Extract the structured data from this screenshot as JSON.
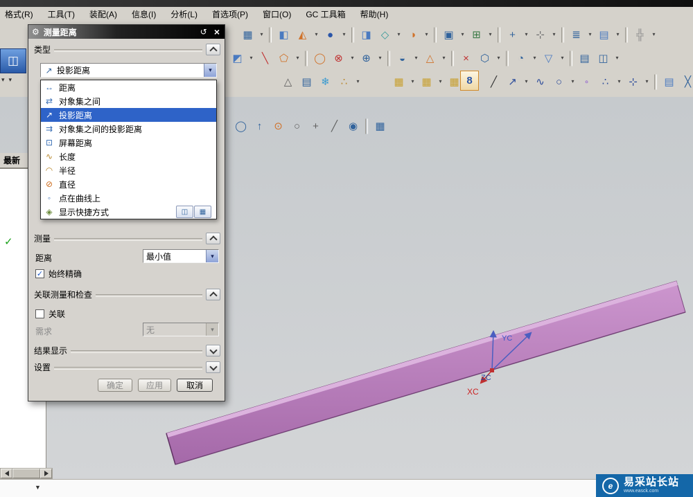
{
  "menu": {
    "items": [
      {
        "label": "格式(R)"
      },
      {
        "label": "工具(T)"
      },
      {
        "label": "装配(A)"
      },
      {
        "label": "信息(I)"
      },
      {
        "label": "分析(L)"
      },
      {
        "label": "首选项(P)"
      },
      {
        "label": "窗口(O)"
      },
      {
        "label": "GC 工具箱"
      },
      {
        "label": "帮助(H)"
      }
    ]
  },
  "icons": {
    "gear": "⚙",
    "reset": "↺",
    "close": "×",
    "dropdown": "▾",
    "check": "✓",
    "link": "8",
    "combo_icon": "↗",
    "shortcut_a": "◫",
    "shortcut_b": "▦",
    "window_frag": "◫",
    "spark_frag": "◈",
    "caret_down": "▼",
    "green_check": "✓",
    "logo_letter": "e"
  },
  "toolbars": {
    "row1": [
      {
        "g": "▦",
        "c": "#31639c",
        "n": "view-layout-icon"
      },
      {
        "g": "▾",
        "a": 1,
        "n": "dropdown-arrow"
      },
      {
        "s": 1,
        "n": "separator"
      },
      {
        "g": "◧",
        "c": "#4a7ac0",
        "n": "shaded-view-icon"
      },
      {
        "g": "◭",
        "c": "#d0722a",
        "n": "orient-view-icon"
      },
      {
        "g": "▾",
        "a": 1,
        "n": "dropdown-arrow"
      },
      {
        "g": "●",
        "c": "#2a55a8",
        "n": "render-style-icon"
      },
      {
        "g": "▾",
        "a": 1,
        "n": "dropdown-arrow"
      },
      {
        "s": 1,
        "n": "separator"
      },
      {
        "g": "◨",
        "c": "#4a7ac0",
        "n": "half-section-icon"
      },
      {
        "g": "◇",
        "c": "#3a9a9a",
        "n": "wireframe-icon"
      },
      {
        "g": "▾",
        "a": 1,
        "n": "dropdown-arrow"
      },
      {
        "g": "◑",
        "c": "#d0722a",
        "n": "shadow-icon"
      },
      {
        "g": "▾",
        "a": 1,
        "n": "dropdown-arrow"
      },
      {
        "s": 1,
        "n": "separator"
      },
      {
        "g": "▣",
        "c": "#31639c",
        "n": "window-icon"
      },
      {
        "g": "▾",
        "a": 1,
        "n": "dropdown-arrow"
      },
      {
        "g": "⊞",
        "c": "#3a7a46",
        "n": "layer-icon"
      },
      {
        "g": "▾",
        "a": 1,
        "n": "dropdown-arrow"
      },
      {
        "s": 1,
        "n": "separator"
      },
      {
        "g": "+",
        "c": "#31639c",
        "n": "datum-icon"
      },
      {
        "g": "▾",
        "a": 1,
        "n": "dropdown-arrow"
      },
      {
        "g": "⊹",
        "c": "#707070",
        "n": "point-icon"
      },
      {
        "g": "▾",
        "a": 1,
        "n": "dropdown-arrow"
      },
      {
        "s": 1,
        "n": "separator"
      },
      {
        "g": "≣",
        "c": "#31639c",
        "n": "list-icon"
      },
      {
        "g": "▾",
        "a": 1,
        "n": "dropdown-arrow"
      },
      {
        "g": "▤",
        "c": "#4a7ac0",
        "n": "table-icon"
      },
      {
        "g": "▾",
        "a": 1,
        "n": "dropdown-arrow"
      },
      {
        "s": 1,
        "n": "separator"
      },
      {
        "g": "╬",
        "c": "#8a8a8a",
        "n": "grid-icon"
      },
      {
        "g": "▾",
        "a": 1,
        "n": "dropdown-arrow"
      }
    ],
    "row2": [
      {
        "g": "◩",
        "c": "#4a7ac0",
        "n": "extrude-icon"
      },
      {
        "g": "▾",
        "a": 1,
        "n": "dropdown-arrow"
      },
      {
        "g": "╲",
        "c": "#c03434",
        "n": "line-icon"
      },
      {
        "g": "⬠",
        "c": "#d0722a",
        "n": "polygon-icon"
      },
      {
        "g": "▾",
        "a": 1,
        "n": "dropdown-arrow"
      },
      {
        "s": 1,
        "n": "separator"
      },
      {
        "g": "◯",
        "c": "#d0722a",
        "n": "circle-icon"
      },
      {
        "g": "⊗",
        "c": "#c03434",
        "n": "hole-icon"
      },
      {
        "g": "▾",
        "a": 1,
        "n": "dropdown-arrow"
      },
      {
        "g": "⊕",
        "c": "#31639c",
        "n": "boolean-unite-icon"
      },
      {
        "g": "▾",
        "a": 1,
        "n": "dropdown-arrow"
      },
      {
        "s": 1,
        "n": "separator"
      },
      {
        "g": "◒",
        "c": "#31639c",
        "n": "revolve-icon"
      },
      {
        "g": "▾",
        "a": 1,
        "n": "dropdown-arrow"
      },
      {
        "g": "△",
        "c": "#d0722a",
        "n": "draft-icon"
      },
      {
        "g": "▾",
        "a": 1,
        "n": "dropdown-arrow"
      },
      {
        "s": 1,
        "n": "separator"
      },
      {
        "g": "×",
        "c": "#c03434",
        "n": "delete-icon"
      },
      {
        "g": "⬡",
        "c": "#31639c",
        "n": "pattern-icon"
      },
      {
        "g": "▾",
        "a": 1,
        "n": "dropdown-arrow"
      },
      {
        "s": 1,
        "n": "separator"
      },
      {
        "g": "◔",
        "c": "#31639c",
        "n": "blend-icon"
      },
      {
        "g": "▾",
        "a": 1,
        "n": "dropdown-arrow"
      },
      {
        "g": "▽",
        "c": "#4a7ac0",
        "n": "chamfer-icon"
      },
      {
        "g": "▾",
        "a": 1,
        "n": "dropdown-arrow"
      },
      {
        "s": 1,
        "n": "separator"
      },
      {
        "g": "▤",
        "c": "#31639c",
        "n": "sheet-icon"
      },
      {
        "g": "◫",
        "c": "#31639c",
        "n": "shell-icon"
      },
      {
        "g": "▾",
        "a": 1,
        "n": "dropdown-arrow"
      }
    ],
    "row3a": [
      {
        "g": "△",
        "c": "#606060",
        "n": "tolerance-icon"
      },
      {
        "g": "▤",
        "c": "#31639c",
        "n": "spreadsheet-icon"
      },
      {
        "g": "❄",
        "c": "#3a9ad0",
        "n": "freeze-icon"
      },
      {
        "g": "∴",
        "c": "#b8862a",
        "n": "points-set-icon"
      },
      {
        "g": "▾",
        "a": 1,
        "n": "dropdown-arrow"
      }
    ],
    "row3b": [
      {
        "g": "▦",
        "c": "#c8a030",
        "n": "group-icon"
      },
      {
        "g": "▾",
        "a": 1,
        "n": "dropdown-arrow"
      },
      {
        "g": "▦",
        "c": "#c8a030",
        "n": "group-icon"
      },
      {
        "g": "▾",
        "a": 1,
        "n": "dropdown-arrow"
      },
      {
        "g": "▦",
        "c": "#c8a030",
        "n": "group-icon"
      },
      {
        "g": "▾",
        "a": 1,
        "n": "dropdown-arrow"
      }
    ],
    "row3c": [
      {
        "g": "╱",
        "c": "#333333",
        "n": "profile-line-icon"
      },
      {
        "g": "↗",
        "c": "#2a4a9a",
        "n": "arc-icon"
      },
      {
        "g": "▾",
        "a": 1,
        "n": "dropdown-arrow"
      },
      {
        "g": "∿",
        "c": "#2a4a9a",
        "n": "spline-icon"
      },
      {
        "g": "○",
        "c": "#2a4a9a",
        "n": "circle2-icon"
      },
      {
        "g": "▾",
        "a": 1,
        "n": "dropdown-arrow"
      },
      {
        "g": "◦",
        "c": "#7a3ad0",
        "n": "point2-icon"
      },
      {
        "g": "∴",
        "c": "#2a4a9a",
        "n": "point-set-icon"
      },
      {
        "g": "▾",
        "a": 1,
        "n": "dropdown-arrow"
      },
      {
        "g": "⊹",
        "c": "#2a4a9a",
        "n": "snap-icon"
      },
      {
        "g": "▾",
        "a": 1,
        "n": "dropdown-arrow"
      },
      {
        "s": 1,
        "n": "separator"
      },
      {
        "g": "▤",
        "c": "#4a7ac0",
        "n": "pattern2-icon"
      },
      {
        "g": "╳",
        "c": "#31639c",
        "n": "cross-icon"
      },
      {
        "g": "▾",
        "a": 1,
        "n": "dropdown-arrow"
      }
    ],
    "row4": [
      {
        "g": "◯",
        "c": "#31639c",
        "n": "select-scope-icon"
      },
      {
        "g": "↑",
        "c": "#31639c",
        "n": "top-selection-icon"
      },
      {
        "g": "⊙",
        "c": "#d0722a",
        "n": "snap-point-icon"
      },
      {
        "g": "○",
        "c": "#606060",
        "n": "circle-snap-icon"
      },
      {
        "g": "+",
        "c": "#606060",
        "n": "plus-snap-icon"
      },
      {
        "g": "╱",
        "c": "#606060",
        "n": "line-snap-icon"
      },
      {
        "g": "◉",
        "c": "#31639c",
        "n": "ball-snap-icon"
      },
      {
        "s": 1,
        "n": "separator"
      },
      {
        "g": "▦",
        "c": "#31639c",
        "n": "grid-snap-icon"
      }
    ]
  },
  "dialog": {
    "title": "测量距离",
    "type_section": "类型",
    "type_value": "投影距离",
    "list": [
      {
        "icon": "↔",
        "c": "#3a6fb5",
        "label": "距离",
        "n": "option-distance"
      },
      {
        "icon": "⇄",
        "c": "#3a6fb5",
        "label": "对象集之间",
        "n": "option-between-object-sets"
      },
      {
        "icon": "↗",
        "c": "#ffffff",
        "label": "投影距离",
        "selected": true,
        "n": "option-projected-distance"
      },
      {
        "icon": "⇉",
        "c": "#3a6fb5",
        "label": "对象集之间的投影距离",
        "n": "option-projected-between-sets"
      },
      {
        "icon": "⊡",
        "c": "#3a6fb5",
        "label": "屏幕距离",
        "n": "option-screen-distance"
      },
      {
        "icon": "∿",
        "c": "#b8862a",
        "label": "长度",
        "n": "option-length"
      },
      {
        "icon": "◠",
        "c": "#b8862a",
        "label": "半径",
        "n": "option-radius"
      },
      {
        "icon": "⊘",
        "c": "#cc6a1a",
        "label": "直径",
        "n": "option-diameter"
      },
      {
        "icon": "◦",
        "c": "#3a6fb5",
        "label": "点在曲线上",
        "n": "option-point-on-curve"
      },
      {
        "icon": "◈",
        "c": "#6a8a3a",
        "label": "显示快捷方式",
        "n": "option-show-shortcuts"
      }
    ],
    "measure_section": "测量",
    "distance_label": "距离",
    "distance_value": "最小值",
    "always_exact_label": "始终精确",
    "assoc_section": "关联测量和检查",
    "assoc_label": "关联",
    "requirement_label": "需求",
    "requirement_value": "无",
    "results_section": "结果显示",
    "settings_section": "设置",
    "ok_label": "确定",
    "apply_label": "应用",
    "cancel_label": "取消"
  },
  "left_panel": {
    "tab": "最新"
  },
  "canvas": {
    "labels": {
      "xc": "XC",
      "yc": "YC",
      "zc": "ZC"
    }
  },
  "watermark": {
    "title": "易采站长站",
    "subtitle": "www.easck.com"
  }
}
